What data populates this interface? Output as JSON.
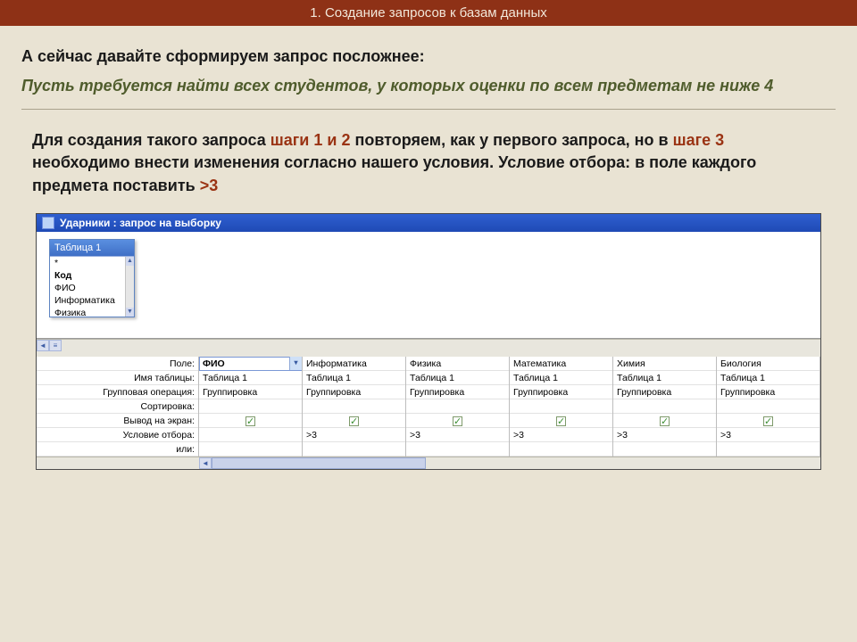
{
  "header": {
    "title": "1. Создание запросов к базам данных"
  },
  "lead": "А сейчас давайте сформируем запрос посложнее:",
  "task": "Пусть требуется найти всех студентов, у которых оценки по всем предметам не ниже 4",
  "instruction": {
    "t1": "Для создания такого запроса ",
    "h1": "шаги 1 и 2",
    "t2": " повторяем, как у первого запроса, но в ",
    "h2": "шаге 3",
    "t3": " необходимо внести изменения согласно нашего условия. Условие отбора: в поле каждого предмета поставить ",
    "h3": ">3"
  },
  "window": {
    "title": "Ударники : запрос на выборку",
    "table_box": {
      "title": "Таблица 1",
      "items": [
        "*",
        "Код",
        "ФИО",
        "Информатика",
        "Физика"
      ]
    },
    "qbe_labels": [
      "Поле:",
      "Имя таблицы:",
      "Групповая операция:",
      "Сортировка:",
      "Вывод на экран:",
      "Условие отбора:",
      "или:"
    ],
    "columns": [
      {
        "field": "ФИО",
        "table": "Таблица 1",
        "groupop": "Группировка",
        "sort": "",
        "show": true,
        "criteria": "",
        "or": "",
        "selected": true
      },
      {
        "field": "Информатика",
        "table": "Таблица 1",
        "groupop": "Группировка",
        "sort": "",
        "show": true,
        "criteria": ">3",
        "or": ""
      },
      {
        "field": "Физика",
        "table": "Таблица 1",
        "groupop": "Группировка",
        "sort": "",
        "show": true,
        "criteria": ">3",
        "or": ""
      },
      {
        "field": "Математика",
        "table": "Таблица 1",
        "groupop": "Группировка",
        "sort": "",
        "show": true,
        "criteria": ">3",
        "or": ""
      },
      {
        "field": "Химия",
        "table": "Таблица 1",
        "groupop": "Группировка",
        "sort": "",
        "show": true,
        "criteria": ">3",
        "or": ""
      },
      {
        "field": "Биология",
        "table": "Таблица 1",
        "groupop": "Группировка",
        "sort": "",
        "show": true,
        "criteria": ">3",
        "or": ""
      }
    ]
  }
}
